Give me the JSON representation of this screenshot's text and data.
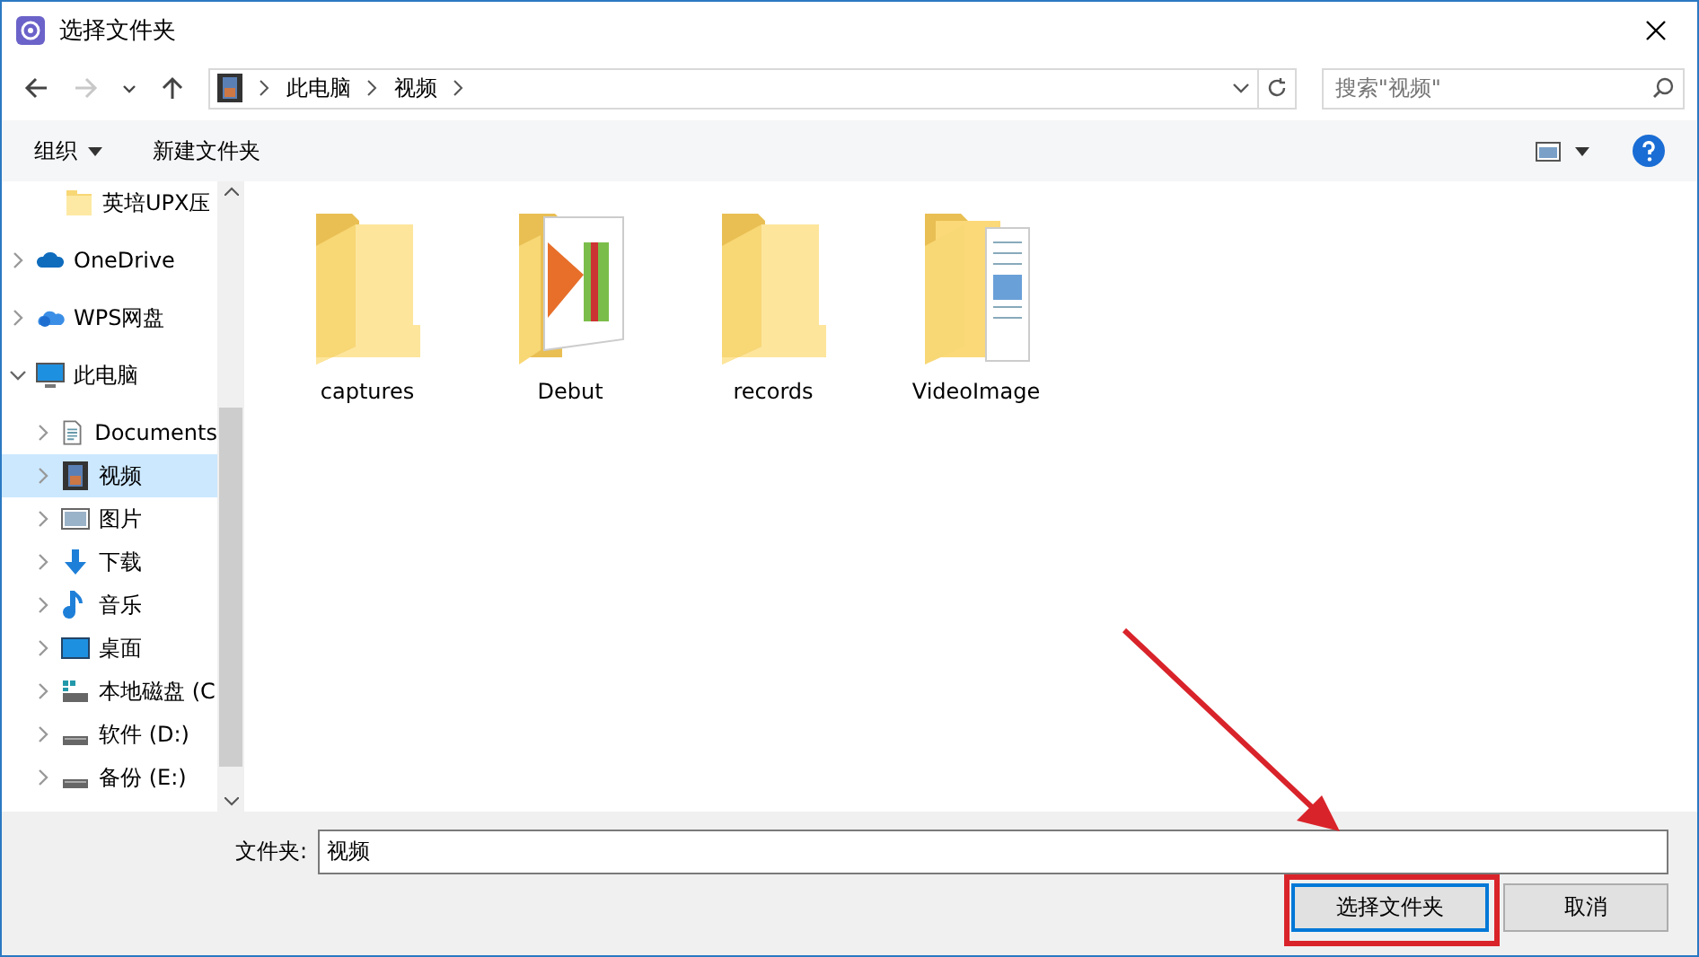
{
  "window": {
    "title": "选择文件夹"
  },
  "nav_buttons": [
    {
      "kind": "back",
      "disabled": false
    },
    {
      "kind": "forward",
      "disabled": true
    },
    {
      "kind": "recent",
      "disabled": false
    },
    {
      "kind": "up",
      "disabled": false
    }
  ],
  "address": {
    "crumbs": [
      "此电脑",
      "视频"
    ]
  },
  "search": {
    "placeholder": "搜索\"视频\""
  },
  "toolbar": {
    "organize": "组织",
    "new_folder": "新建文件夹"
  },
  "sidebar": {
    "items": [
      {
        "label": "英培UPX压",
        "kind": "folder",
        "selected": false
      },
      {
        "label": "OneDrive",
        "kind": "cloud",
        "selected": false,
        "expanded": false
      },
      {
        "label": "WPS网盘",
        "kind": "cloud2",
        "selected": false,
        "expanded": false
      },
      {
        "label": "此电脑",
        "kind": "pc",
        "selected": false,
        "expanded": true,
        "children": [
          {
            "label": "Documents",
            "kind": "doc",
            "selected": false,
            "expanded": false
          },
          {
            "label": "视频",
            "kind": "video",
            "selected": true,
            "expanded": false
          },
          {
            "label": "图片",
            "kind": "picture",
            "selected": false,
            "expanded": false
          },
          {
            "label": "下载",
            "kind": "download",
            "selected": false,
            "expanded": false
          },
          {
            "label": "音乐",
            "kind": "music",
            "selected": false,
            "expanded": false
          },
          {
            "label": "桌面",
            "kind": "desktop",
            "selected": false,
            "expanded": false
          },
          {
            "label": "本地磁盘 (C",
            "kind": "sysdrive",
            "selected": false,
            "expanded": false
          },
          {
            "label": "软件 (D:)",
            "kind": "drive",
            "selected": false,
            "expanded": false
          },
          {
            "label": "备份 (E:)",
            "kind": "drive",
            "selected": false,
            "expanded": false
          }
        ]
      }
    ]
  },
  "folders": [
    {
      "name": "captures",
      "kind": "plain"
    },
    {
      "name": "Debut",
      "kind": "media"
    },
    {
      "name": "records",
      "kind": "plain"
    },
    {
      "name": "VideoImage",
      "kind": "document"
    }
  ],
  "folder_field": {
    "label": "文件夹:",
    "value": "视频"
  },
  "buttons": [
    {
      "label": "选择文件夹",
      "default": true
    },
    {
      "label": "取消",
      "default": false
    }
  ],
  "annotations": {
    "highlight_frame": true,
    "pointer_arrow": true
  }
}
